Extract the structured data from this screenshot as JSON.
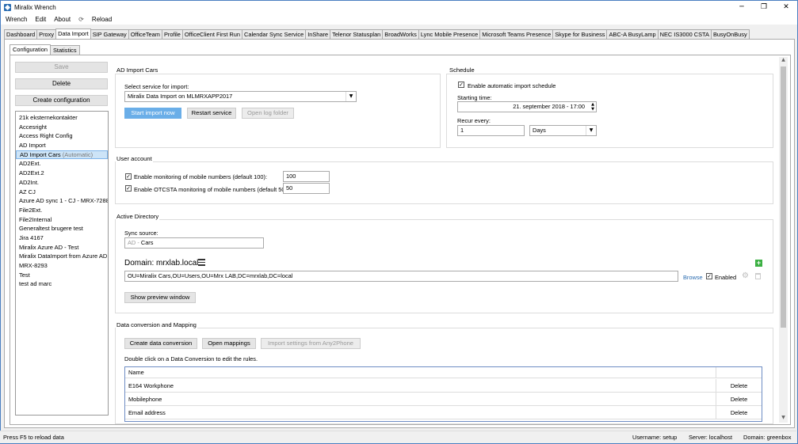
{
  "window": {
    "title": "Miralix Wrench",
    "minimize": "─",
    "maximize": "❐",
    "close": "✕"
  },
  "menu": {
    "items": [
      "Wrench",
      "Edit",
      "About"
    ],
    "reload_icon": "reload-icon",
    "reload": "Reload"
  },
  "tabs": [
    "Dashboard",
    "Proxy",
    "Data Import",
    "SIP Gateway",
    "OfficeTeam",
    "Profile",
    "OfficeClient First Run",
    "Calendar Sync Service",
    "InShare",
    "Telenor Statusplan",
    "BroadWorks",
    "Lync Mobile Presence",
    "Microsoft Teams Presence",
    "Skype for Business",
    "ABC-A BusyLamp",
    "NEC IS3000 CSTA",
    "BusyOnBusy"
  ],
  "active_tab": "Data Import",
  "subtabs": [
    "Configuration",
    "Statistics"
  ],
  "sidebar": {
    "save": "Save",
    "delete": "Delete",
    "create": "Create configuration",
    "items": [
      "21k eksternekontakter",
      "Accesright",
      "Access Right Config",
      "AD Import",
      "AD Import Cars",
      "AD2Ext.",
      "AD2Ext.2",
      "AD2Int.",
      "AZ CJ",
      "Azure AD sync 1 - CJ - MRX-7288",
      "File2Ext.",
      "File2Internal",
      "Generaltest brugere test",
      "Jira 4167",
      "Miralix Azure AD - Test",
      "Miralix DataImport from Azure AD",
      "MRX-8293",
      "Test",
      "test ad marc"
    ],
    "selected_index": 4,
    "selected_tag": "(Automatic)"
  },
  "ad_import": {
    "title": "AD Import Cars",
    "select_label": "Select service for import:",
    "service": "Miralix Data Import on MLMRXAPP2017",
    "start": "Start import now",
    "restart": "Restart service",
    "open_log": "Open log folder"
  },
  "schedule": {
    "title": "Schedule",
    "enable_label": "Enable automatic import schedule",
    "enabled": true,
    "starting_label": "Starting time:",
    "starting_value": "21. september 2018 - 17:00",
    "recur_label": "Recur every:",
    "recur_value": "1",
    "recur_unit": "Days"
  },
  "user_account": {
    "title": "User account",
    "mobile_label": "Enable monitoring of mobile numbers (default 100):",
    "mobile_value": "100",
    "otc_label": "Enable OTCSTA monitoring of mobile numbers (default 50):",
    "otc_value": "50"
  },
  "active_directory": {
    "title": "Active Directory",
    "sync_label": "Sync source:",
    "sync_prefix": "AD -",
    "sync_value": "Cars",
    "domain_label": "Domain: mrxlab.local",
    "ou_value": "OU=Miralix Cars,OU=Users,OU=Mrx LAB,DC=mrxlab,DC=local",
    "browse": "Browse",
    "enabled_label": "Enabled",
    "preview": "Show preview window"
  },
  "mapping": {
    "title": "Data conversion and Mapping",
    "create": "Create data conversion",
    "open": "Open mappings",
    "import_settings": "Import settings from Any2Phone",
    "hint": "Double click on a Data Conversion to edit the rules.",
    "col_name": "Name",
    "rows": [
      {
        "name": "E164 Workphone",
        "action": "Delete"
      },
      {
        "name": "Mobilephone",
        "action": "Delete"
      },
      {
        "name": "Email address",
        "action": "Delete"
      }
    ]
  },
  "status": {
    "hint": "Press F5 to reload data",
    "username": "Username:  setup",
    "server": "Server:  localhost",
    "domain": "Domain:  greenbox"
  },
  "colors": {
    "accent": "#6aaee8",
    "link": "#2b6cb0",
    "plus": "#3cb043"
  }
}
